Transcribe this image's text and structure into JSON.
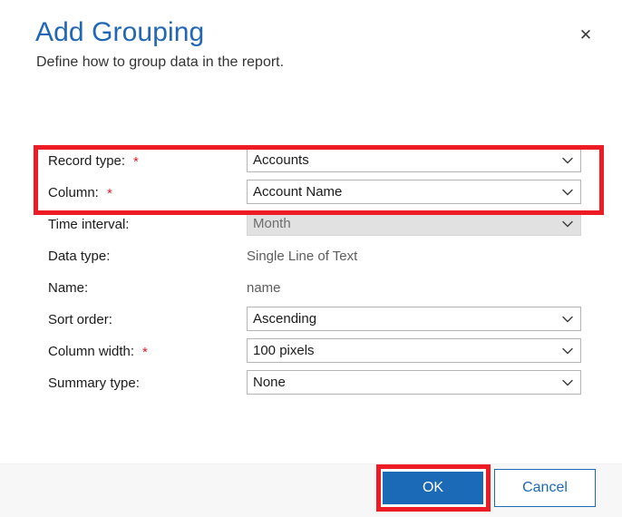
{
  "header": {
    "title": "Add Grouping",
    "subtitle": "Define how to group data in the report.",
    "close_label": "✕"
  },
  "form": {
    "required_marker": "*",
    "rows": [
      {
        "label": "Record type:",
        "required": true,
        "type": "dropdown",
        "value": "Accounts",
        "disabled": false,
        "name": "record-type"
      },
      {
        "label": "Column:",
        "required": true,
        "type": "dropdown",
        "value": "Account Name",
        "disabled": false,
        "name": "column"
      },
      {
        "label": "Time interval:",
        "required": false,
        "type": "dropdown",
        "value": "Month",
        "disabled": true,
        "name": "time-interval"
      },
      {
        "label": "Data type:",
        "required": false,
        "type": "static",
        "value": "Single Line of Text",
        "disabled": false,
        "name": "data-type"
      },
      {
        "label": "Name:",
        "required": false,
        "type": "static",
        "value": "name",
        "disabled": false,
        "name": "name"
      },
      {
        "label": "Sort order:",
        "required": false,
        "type": "dropdown",
        "value": "Ascending",
        "disabled": false,
        "name": "sort-order"
      },
      {
        "label": "Column width:",
        "required": true,
        "type": "dropdown",
        "value": "100 pixels",
        "disabled": false,
        "name": "column-width"
      },
      {
        "label": "Summary type:",
        "required": false,
        "type": "dropdown",
        "value": "None",
        "disabled": false,
        "name": "summary-type"
      }
    ]
  },
  "footer": {
    "ok_label": "OK",
    "cancel_label": "Cancel"
  },
  "colors": {
    "title_blue": "#2267b5",
    "accent_blue": "#1a6ab8",
    "required_red": "#d4202a",
    "annotation_red": "#ed1c24",
    "footer_background": "#f7f7f7",
    "disabled_background": "#e1e1e1"
  },
  "annotations": [
    {
      "name": "annotation-rect-fields",
      "around": "Record type and Column rows"
    },
    {
      "name": "annotation-rect-ok",
      "around": "OK button"
    }
  ]
}
